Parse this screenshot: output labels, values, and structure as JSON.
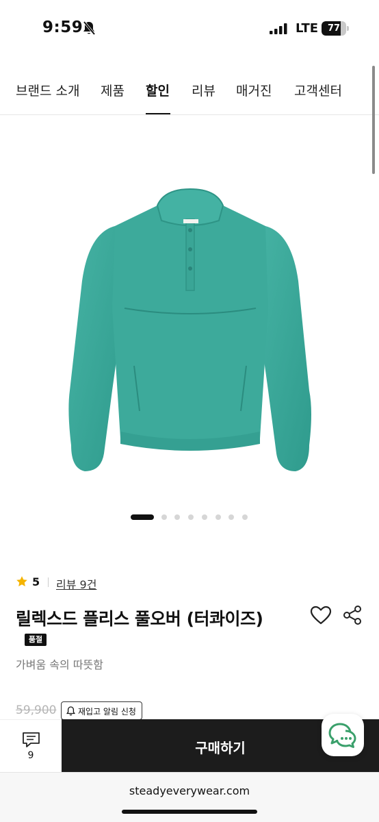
{
  "status_bar": {
    "time": "9:59",
    "network": "LTE",
    "battery": "77",
    "battery_level": 0.77
  },
  "nav": {
    "tabs": [
      {
        "label": "브랜드 소개",
        "active": false
      },
      {
        "label": "제품",
        "active": false
      },
      {
        "label": "할인",
        "active": true
      },
      {
        "label": "리뷰",
        "active": false
      },
      {
        "label": "매거진",
        "active": false
      },
      {
        "label": "고객센터",
        "active": false
      }
    ]
  },
  "product": {
    "image_icon": "teal-fleece-pullover",
    "image_color": "#3aa89a",
    "carousel": {
      "total": 8,
      "current": 1
    },
    "rating": "5",
    "review_link": "리뷰 9건",
    "title": "릴렉스드 플리스 풀오버 (터콰이즈)",
    "badge": "품절",
    "subtitle": "가벼움 속의 따뜻함",
    "price_original": "59,900",
    "restock_label": "재입고 알림 신청"
  },
  "icons": {
    "favorite": "heart-icon",
    "share": "share-icon",
    "chat": "chat-icon",
    "comment": "comment-icon"
  },
  "actions": {
    "comment_count": "9",
    "buy_label": "구매하기"
  },
  "browser": {
    "url": "steadyeverywear.com"
  },
  "colors": {
    "star": "#f5b400",
    "buy_bg": "#1c1c1c",
    "chat_accent": "#3aa06b"
  }
}
